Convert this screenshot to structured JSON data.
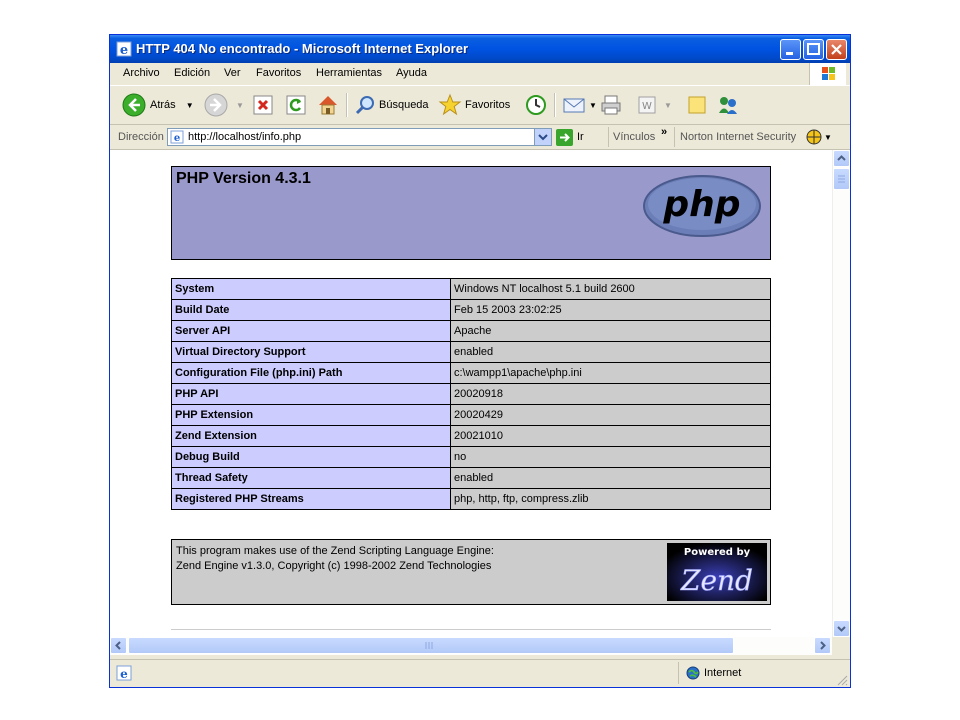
{
  "window": {
    "title": "HTTP 404 No encontrado - Microsoft Internet Explorer"
  },
  "menu": [
    "Archivo",
    "Edición",
    "Ver",
    "Favoritos",
    "Herramientas",
    "Ayuda"
  ],
  "toolbar": {
    "back_label": "Atrás",
    "search_label": "Búsqueda",
    "favorites_label": "Favoritos"
  },
  "address": {
    "label": "Dirección",
    "url": "http://localhost/info.php",
    "go_label": "Ir",
    "links_label": "Vínculos",
    "norton_label": "Norton Internet Security"
  },
  "page": {
    "header_title": "PHP Version 4.3.1",
    "logo_text": "php",
    "rows": [
      {
        "key": "System",
        "value": "Windows NT localhost 5.1 build 2600"
      },
      {
        "key": "Build Date",
        "value": "Feb 15 2003 23:02:25"
      },
      {
        "key": "Server API",
        "value": "Apache"
      },
      {
        "key": "Virtual Directory Support",
        "value": "enabled"
      },
      {
        "key": "Configuration File (php.ini) Path",
        "value": "c:\\wampp1\\apache\\php.ini"
      },
      {
        "key": "PHP API",
        "value": "20020918"
      },
      {
        "key": "PHP Extension",
        "value": "20020429"
      },
      {
        "key": "Zend Extension",
        "value": "20021010"
      },
      {
        "key": "Debug Build",
        "value": "no"
      },
      {
        "key": "Thread Safety",
        "value": "enabled"
      },
      {
        "key": "Registered PHP Streams",
        "value": "php, http, ftp, compress.zlib"
      }
    ],
    "zend_line1": "This program makes use of the Zend Scripting Language Engine:",
    "zend_line2": "Zend Engine v1.3.0, Copyright (c) 1998-2002 Zend Technologies",
    "zend_logo_top": "Powered by",
    "zend_logo_main": "Zend"
  },
  "status": {
    "zone_label": "Internet"
  },
  "colors": {
    "php_header": "#9999cc",
    "key_cell": "#ccccff",
    "value_cell": "#cccccc"
  }
}
